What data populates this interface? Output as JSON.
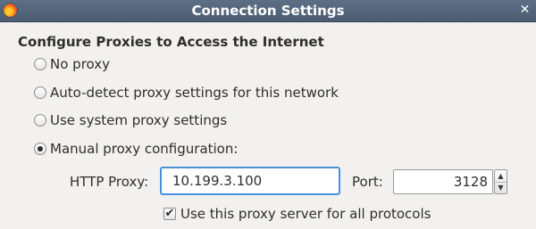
{
  "window": {
    "title": "Connection Settings",
    "app_icon": "firefox-icon",
    "close_glyph": "✕"
  },
  "section": {
    "heading": "Configure Proxies to Access the Internet"
  },
  "proxy_options": [
    {
      "label": "No proxy",
      "checked": false
    },
    {
      "label": "Auto-detect proxy settings for this network",
      "checked": false
    },
    {
      "label": "Use system proxy settings",
      "checked": false
    },
    {
      "label": "Manual proxy configuration:",
      "checked": true
    }
  ],
  "http_proxy": {
    "label": "HTTP Proxy:",
    "value": "10.199.3.100"
  },
  "port": {
    "label": "Port:",
    "value": "3128"
  },
  "all_protocols": {
    "label": "Use this proxy server for all protocols",
    "checked": true,
    "check_glyph": "✔"
  },
  "colors": {
    "titlebar": "#4c5d72",
    "focus_border": "#4a90d9",
    "background": "#f2f1f0"
  }
}
